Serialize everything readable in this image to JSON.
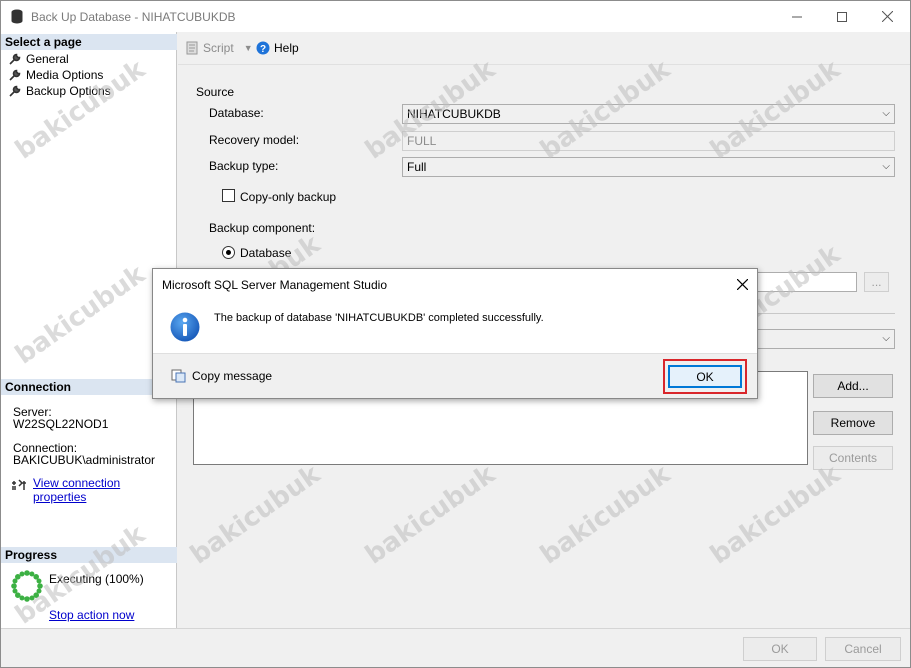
{
  "window": {
    "title": "Back Up Database - NIHATCUBUKDB",
    "minimize_icon": "minimize-icon",
    "maximize_icon": "maximize-icon",
    "close_icon": "close-icon"
  },
  "sidebar": {
    "select_page_heading": "Select a page",
    "pages": [
      {
        "label": "General",
        "icon": "wrench-icon"
      },
      {
        "label": "Media Options",
        "icon": "wrench-icon"
      },
      {
        "label": "Backup Options",
        "icon": "wrench-icon"
      }
    ],
    "connection_heading": "Connection",
    "server_label": "Server:",
    "server_value": "W22SQL22NOD1",
    "connection_label": "Connection:",
    "connection_value": "BAKICUBUK\\administrator",
    "view_connection_link": "View connection properties",
    "progress_heading": "Progress",
    "progress_status": "Executing (100%)",
    "progress_percent": 100,
    "stop_action_link": "Stop action now"
  },
  "toolbar": {
    "script_label": "Script",
    "help_label": "Help"
  },
  "form": {
    "source_label": "Source",
    "database_label": "Database:",
    "database_value": "NIHATCUBUKDB",
    "recovery_model_label": "Recovery model:",
    "recovery_model_value": "FULL",
    "backup_type_label": "Backup type:",
    "backup_type_value": "Full",
    "copy_only_label": "Copy-only backup",
    "copy_only_checked": false,
    "backup_component_label": "Backup component:",
    "component_database_label": "Database",
    "browse_button": "...",
    "add_button": "Add...",
    "remove_button": "Remove",
    "contents_button": "Contents"
  },
  "dialog": {
    "title": "Microsoft SQL Server Management Studio",
    "message": "The backup of database 'NIHATCUBUKDB' completed successfully.",
    "copy_message_label": "Copy message",
    "ok_label": "OK",
    "info_icon": "info-icon"
  },
  "bottom": {
    "ok_label": "OK",
    "cancel_label": "Cancel"
  },
  "watermark_text": "bakicubuk",
  "colors": {
    "accent": "#0078d7",
    "highlight_border": "#d9262b",
    "section_header_bg": "#dbe5f1",
    "progress_ring": "#3cb043"
  }
}
